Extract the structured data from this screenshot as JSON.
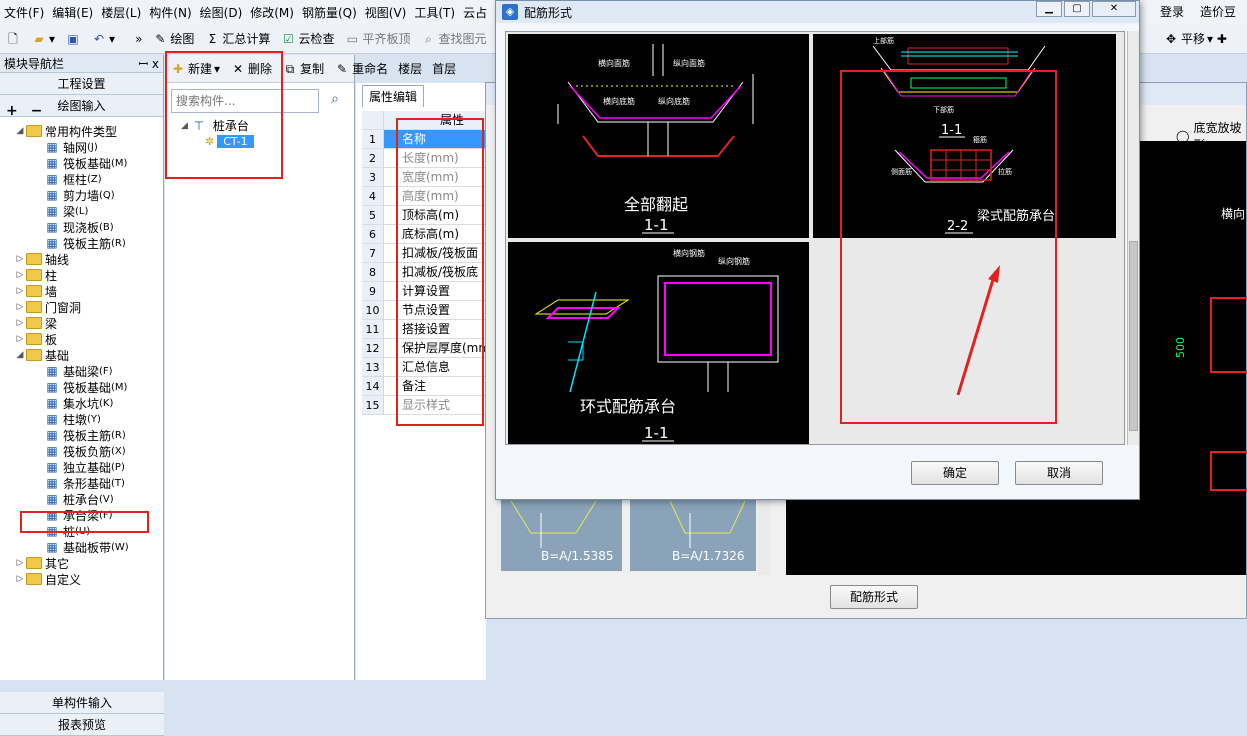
{
  "menu": [
    "文件(F)",
    "编辑(E)",
    "楼层(L)",
    "构件(N)",
    "绘图(D)",
    "修改(M)",
    "钢筋量(Q)",
    "视图(V)",
    "工具(T)",
    "云占"
  ],
  "menu_right": [
    "登录",
    "造价豆"
  ],
  "toolbar": [
    "绘图",
    "汇总计算",
    "云检查",
    "平齐板顶",
    "查找图元"
  ],
  "toolbar_right": [
    "平移"
  ],
  "nav": {
    "title": "模块导航栏",
    "pin": "ꟷ x",
    "sections": [
      "工程设置",
      "绘图输入"
    ],
    "bottom": [
      "单构件输入",
      "报表预览"
    ],
    "tree": [
      {
        "label": "常用构件类型",
        "level": 0,
        "folder": true,
        "open": true
      },
      {
        "label": "轴网",
        "shortcut": "(J)",
        "level": 1
      },
      {
        "label": "筏板基础",
        "shortcut": "(M)",
        "level": 1
      },
      {
        "label": "框柱",
        "shortcut": "(Z)",
        "level": 1
      },
      {
        "label": "剪力墙",
        "shortcut": "(Q)",
        "level": 1
      },
      {
        "label": "梁",
        "shortcut": "(L)",
        "level": 1
      },
      {
        "label": "现浇板",
        "shortcut": "(B)",
        "level": 1
      },
      {
        "label": "筏板主筋",
        "shortcut": "(R)",
        "level": 1
      },
      {
        "label": "轴线",
        "level": 0,
        "folder": true
      },
      {
        "label": "柱",
        "level": 0,
        "folder": true
      },
      {
        "label": "墙",
        "level": 0,
        "folder": true
      },
      {
        "label": "门窗洞",
        "level": 0,
        "folder": true
      },
      {
        "label": "梁",
        "level": 0,
        "folder": true
      },
      {
        "label": "板",
        "level": 0,
        "folder": true
      },
      {
        "label": "基础",
        "level": 0,
        "folder": true,
        "open": true
      },
      {
        "label": "基础梁",
        "shortcut": "(F)",
        "level": 1
      },
      {
        "label": "筏板基础",
        "shortcut": "(M)",
        "level": 1
      },
      {
        "label": "集水坑",
        "shortcut": "(K)",
        "level": 1
      },
      {
        "label": "柱墩",
        "shortcut": "(Y)",
        "level": 1
      },
      {
        "label": "筏板主筋",
        "shortcut": "(R)",
        "level": 1
      },
      {
        "label": "筏板负筋",
        "shortcut": "(X)",
        "level": 1
      },
      {
        "label": "独立基础",
        "shortcut": "(P)",
        "level": 1
      },
      {
        "label": "条形基础",
        "shortcut": "(T)",
        "level": 1
      },
      {
        "label": "桩承台",
        "shortcut": "(V)",
        "level": 1
      },
      {
        "label": "承台梁",
        "shortcut": "(F)",
        "level": 1
      },
      {
        "label": "桩",
        "shortcut": "(U)",
        "level": 1
      },
      {
        "label": "基础板带",
        "shortcut": "(W)",
        "level": 1
      },
      {
        "label": "其它",
        "level": 0,
        "folder": true
      },
      {
        "label": "自定义",
        "level": 0,
        "folder": true
      }
    ]
  },
  "component": {
    "new": "新建",
    "delete": "删除",
    "copy": "复制",
    "rename": "重命名",
    "floor_label": "楼层",
    "floor_value": "首层",
    "search_placeholder": "搜索构件...",
    "tree_root": "桩承台",
    "tree_child": "CT-1"
  },
  "props": {
    "tab": "属性编辑",
    "header": "属性",
    "rows": [
      {
        "n": "1",
        "name": "名称",
        "state": "sel"
      },
      {
        "n": "2",
        "name": "长度(mm)",
        "state": "gray"
      },
      {
        "n": "3",
        "name": "宽度(mm)",
        "state": "gray"
      },
      {
        "n": "4",
        "name": "高度(mm)",
        "state": "gray"
      },
      {
        "n": "5",
        "name": "顶标高(m)",
        "state": ""
      },
      {
        "n": "6",
        "name": "底标高(m)",
        "state": ""
      },
      {
        "n": "7",
        "name": "扣减板/筏板面",
        "state": ""
      },
      {
        "n": "8",
        "name": "扣减板/筏板底",
        "state": ""
      },
      {
        "n": "9",
        "name": "计算设置",
        "state": ""
      },
      {
        "n": "10",
        "name": "节点设置",
        "state": ""
      },
      {
        "n": "11",
        "name": "搭接设置",
        "state": ""
      },
      {
        "n": "12",
        "name": "保护层厚度(mm",
        "state": ""
      },
      {
        "n": "13",
        "name": "汇总信息",
        "state": ""
      },
      {
        "n": "14",
        "name": "备注",
        "state": ""
      },
      {
        "n": "15",
        "name": "显示样式",
        "state": "gray"
      }
    ]
  },
  "bg_dialog": {
    "radio": "底宽放坡形",
    "dim": "500",
    "label_top": "横向",
    "thumb1": "B=A/1.5385",
    "thumb2": "B=A/1.7326",
    "button": "配筋形式"
  },
  "dialog": {
    "title": "配筋形式",
    "ok": "确定",
    "cancel": "取消",
    "opt1_title": "全部翻起",
    "opt1_sub": "1-1",
    "opt2_sec1": "1-1",
    "opt2_sec2": "2-2",
    "opt2_title": "梁式配筋承台",
    "opt3_title": "环式配筋承台",
    "opt3_sub": "1-1",
    "lbl_hx": "横向面筋",
    "lbl_zx": "纵向面筋",
    "lbl_hd": "横向底筋",
    "lbl_zd": "纵向底筋",
    "lbl_hg": "横向钢筋",
    "lbl_zg": "纵向钢筋",
    "lbl_top": "上部筋",
    "lbl_bot": "下部筋",
    "lbl_hoop": "箍筋",
    "lbl_side": "侧面筋",
    "lbl_tie": "拉筋"
  }
}
